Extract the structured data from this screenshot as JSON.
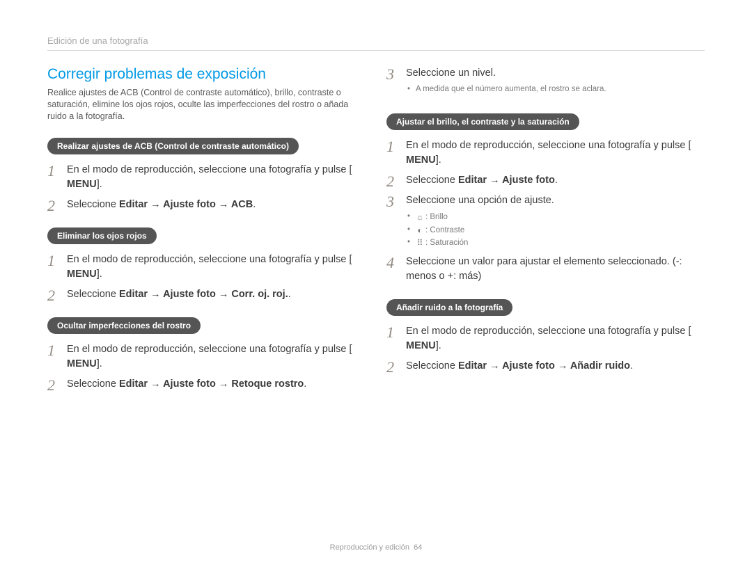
{
  "running_head": "Edición de una fotografía",
  "section_title": "Corregir problemas de exposición",
  "intro": "Realice ajustes de ACB (Control de contraste automático), brillo, contraste o saturación, elimine los ojos rojos, oculte las imperfecciones del rostro o añada ruido a la fotografía.",
  "sub_acb": {
    "title": "Realizar ajustes de ACB (Control de contraste automático)",
    "step1_a": "En el modo de reproducción, seleccione una fotografía y pulse [",
    "menu": "MENU",
    "step1_b": "].",
    "step2_a": "Seleccione ",
    "step2_bold": "Editar → Ajuste foto → ACB",
    "step2_b": "."
  },
  "sub_redeye": {
    "title": "Eliminar los ojos rojos",
    "step1_a": "En el modo de reproducción, seleccione una fotografía y pulse [",
    "menu": "MENU",
    "step1_b": "].",
    "step2_a": "Seleccione ",
    "step2_bold": "Editar → Ajuste foto → Corr. oj. roj.",
    "step2_b": "."
  },
  "sub_face": {
    "title": "Ocultar imperfecciones del rostro",
    "step1_a": "En el modo de reproducción, seleccione una fotografía y pulse [",
    "menu": "MENU",
    "step1_b": "].",
    "step2_a": "Seleccione ",
    "step2_bold": "Editar → Ajuste foto → Retoque rostro",
    "step2_b": "."
  },
  "sub_level": {
    "step3": "Seleccione un nivel.",
    "bullet": "A medida que el número aumenta, el rostro se aclara."
  },
  "sub_bcs": {
    "title": "Ajustar el brillo, el contraste y la saturación",
    "step1_a": "En el modo de reproducción, seleccione una fotografía y pulse [",
    "menu": "MENU",
    "step1_b": "].",
    "step2_a": "Seleccione ",
    "step2_bold": "Editar → Ajuste foto",
    "step2_b": ".",
    "step3": "Seleccione una opción de ajuste.",
    "opt1": ": Brillo",
    "opt2": ": Contraste",
    "opt3": ": Saturación",
    "step4": "Seleccione un valor para ajustar el elemento seleccionado. (-: menos o +: más)"
  },
  "sub_noise": {
    "title": "Añadir ruido a la fotografía",
    "step1_a": "En el modo de reproducción, seleccione una fotografía y pulse [",
    "menu": "MENU",
    "step1_b": "].",
    "step2_a": "Seleccione ",
    "step2_bold": "Editar → Ajuste foto → Añadir ruido",
    "step2_b": "."
  },
  "footer_label": "Reproducción y edición",
  "footer_page": "64"
}
